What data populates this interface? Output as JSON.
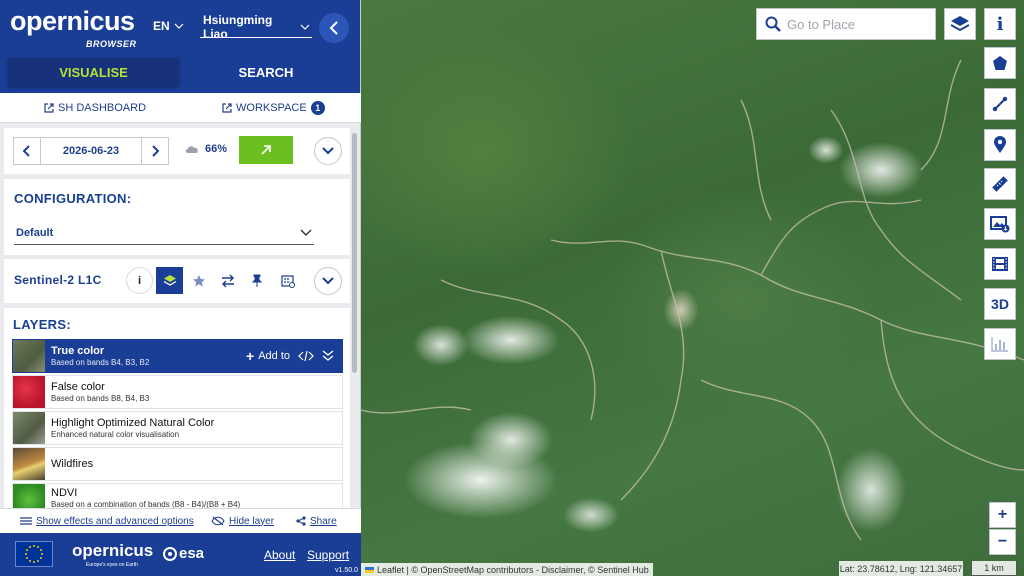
{
  "app": {
    "logo_name": "opernicus",
    "logo_sub": "BROWSER",
    "language": "EN",
    "user": "Hsiungming Liao"
  },
  "tabs": {
    "visualise": "VISUALISE",
    "search": "SEARCH"
  },
  "links": {
    "dashboard": "SH DASHBOARD",
    "workspace": "WORKSPACE",
    "workspace_count": "1"
  },
  "date": {
    "value": "2026-06-23",
    "cloud": "66%"
  },
  "configuration": {
    "heading": "CONFIGURATION:",
    "selected": "Default"
  },
  "dataset": {
    "name": "Sentinel-2 L1C"
  },
  "layers": {
    "heading": "LAYERS:",
    "add_label": "Add to",
    "items": [
      {
        "title": "True color",
        "desc": "Based on bands B4, B3, B2",
        "selected": true
      },
      {
        "title": "False color",
        "desc": "Based on bands B8, B4, B3"
      },
      {
        "title": "Highlight Optimized Natural Color",
        "desc": "Enhanced natural color visualisation"
      },
      {
        "title": "Wildfires",
        "desc": ""
      },
      {
        "title": "NDVI",
        "desc": "Based on a combination of bands (B8 - B4)/(B8 + B4)"
      }
    ]
  },
  "bottom": {
    "effects": "Show effects and advanced options",
    "hide": "Hide layer",
    "share": "Share"
  },
  "footer": {
    "copernicus": "opernicus",
    "tagline": "Europe's eyes on Earth",
    "esa": "esa",
    "about": "About",
    "support": "Support",
    "version": "v1.50.0"
  },
  "map": {
    "search_placeholder": "Go to Place",
    "three_d": "3D",
    "zoom_in": "+",
    "zoom_out": "−",
    "attribution": "Leaflet | © OpenStreetMap contributors - Disclaimer, © Sentinel Hub",
    "coords": "Lat: 23.78612, Lng: 121.34657",
    "scale": "1 km"
  },
  "colors": {
    "brand": "#1a3e95",
    "accent": "#b5e33a",
    "action": "#6bbf1f"
  }
}
